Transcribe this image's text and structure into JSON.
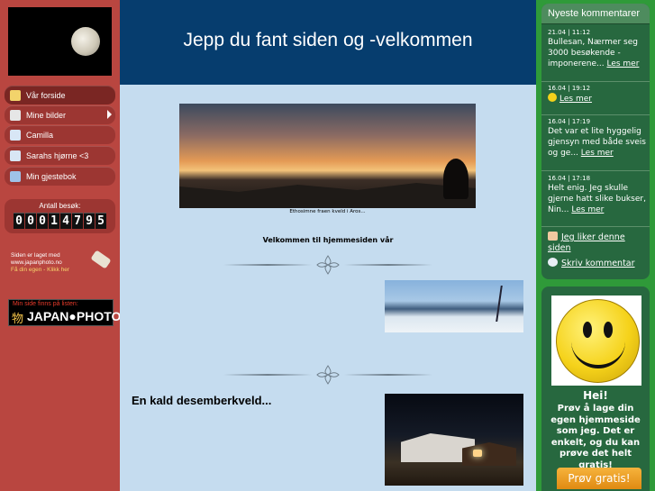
{
  "site": {
    "title": "Jepp du fant siden og -velkommen"
  },
  "nav": {
    "items": [
      {
        "label": "Vår forside",
        "icon": "home-icon"
      },
      {
        "label": "Mine bilder",
        "icon": "photos-icon"
      },
      {
        "label": "Camilla",
        "icon": "document-icon"
      },
      {
        "label": "Sarahs hjørne <3",
        "icon": "document-icon"
      },
      {
        "label": "Min gjestebok",
        "icon": "guestbook-icon"
      }
    ]
  },
  "counter": {
    "label": "Antall besøk:",
    "value": "00014795"
  },
  "promo": {
    "line1": "Siden er laget med",
    "line2": "www.japanphoto.no",
    "line3": "Få din egen - Klikk her"
  },
  "banner": {
    "top": "Min side finns på listen:",
    "kanji": "物",
    "name": "JAPAN●PHOTO"
  },
  "content": {
    "image_caption": "Ethosimne fraen kveld i Aros...",
    "welcome": "Velkommen til hjemmesiden vår",
    "post_title": "En kald desemberkveld..."
  },
  "comments": {
    "header": "Nyeste kommentarer",
    "items": [
      {
        "date": "21.04 | 11:12",
        "text": "Bullesan, Nærmer seg 3000 besøkende - imponerene...",
        "more": "Les mer"
      },
      {
        "date": "16.04 | 19:12",
        "text": "",
        "more": "Les mer"
      },
      {
        "date": "16.04 | 17:19",
        "text": "Det var et lite hyggelig gjensyn med både sveis og ge...",
        "more": "Les mer"
      },
      {
        "date": "16.04 | 17:18",
        "text": "Helt enig. Jeg skulle gjerne hatt slike bukser, Nin...",
        "more": "Les mer"
      }
    ],
    "like": "Jeg liker denne siden",
    "write": "Skriv kommentar"
  },
  "ad": {
    "title": "Hei!",
    "text": "Prøv å lage din egen hjemmeside som jeg. Det er enkelt, og du kan prøve det helt gratis!",
    "button": "Prøv gratis!"
  },
  "colors": {
    "left": "#b94640",
    "header": "#063d6e",
    "content": "#c5dcef",
    "right": "#2f9a39"
  }
}
